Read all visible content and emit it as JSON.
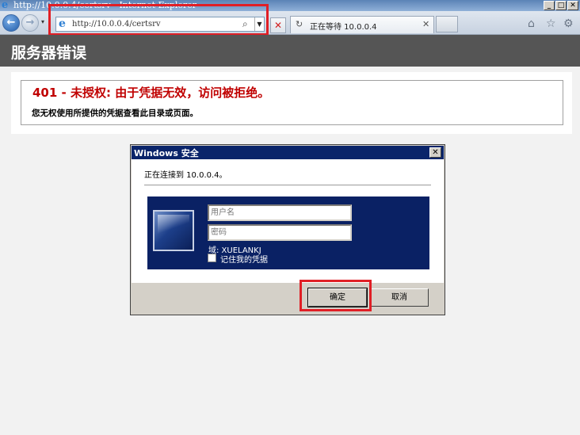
{
  "browser": {
    "title": "http://10.0.0.4/certsrv - Internet Explorer",
    "address": "http://10.0.0.4/certsrv",
    "tab_label": "正在等待 10.0.0.4",
    "window_buttons": {
      "minimize": "_",
      "maximize": "□",
      "close": "✕"
    }
  },
  "page": {
    "header_title": "服务器错误",
    "error_title": "401 - 未授权: 由于凭据无效，访问被拒绝。",
    "error_description": "您无权使用所提供的凭据查看此目录或页面。"
  },
  "dialog": {
    "title": "Windows 安全",
    "connecting_text": "正在连接到 10.0.0.4。",
    "username_placeholder": "用户名",
    "password_placeholder": "密码",
    "domain_text": "域: XUELANKJ",
    "remember_label": "记住我的凭据",
    "ok_label": "确定",
    "cancel_label": "取消"
  },
  "colors": {
    "header_bg": "#555555",
    "error_red": "#c00000",
    "dialog_title_bg": "#0a246a",
    "cred_panel_bg": "#0a2164",
    "annotation_red": "#e01f26"
  }
}
